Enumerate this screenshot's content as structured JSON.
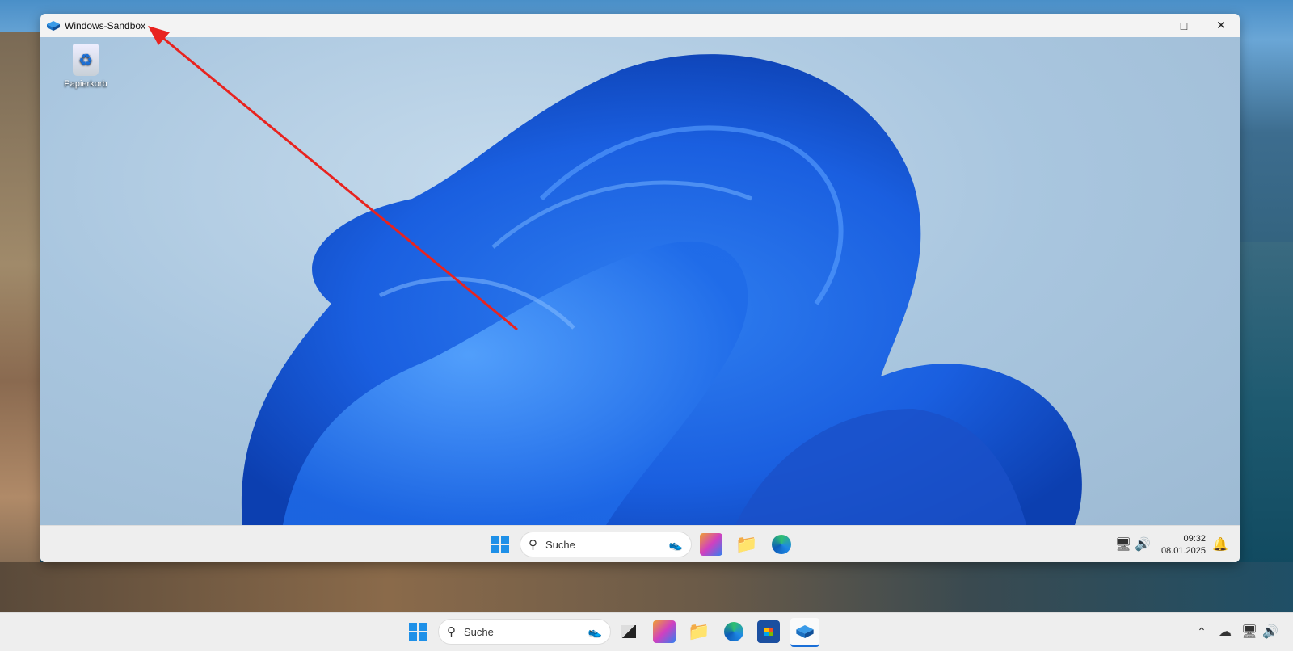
{
  "window": {
    "title": "Windows-Sandbox",
    "minimize_icon": "minimize-icon",
    "maximize_icon": "maximize-icon",
    "close_icon": "close-icon"
  },
  "desktop": {
    "recycle_bin_label": "Papierkorb"
  },
  "inner_taskbar": {
    "search_placeholder": "Suche",
    "time": "09:32",
    "date": "08.01.2025"
  },
  "outer_taskbar": {
    "search_placeholder": "Suche"
  },
  "annotation": {
    "arrow_color": "#e8231f"
  }
}
